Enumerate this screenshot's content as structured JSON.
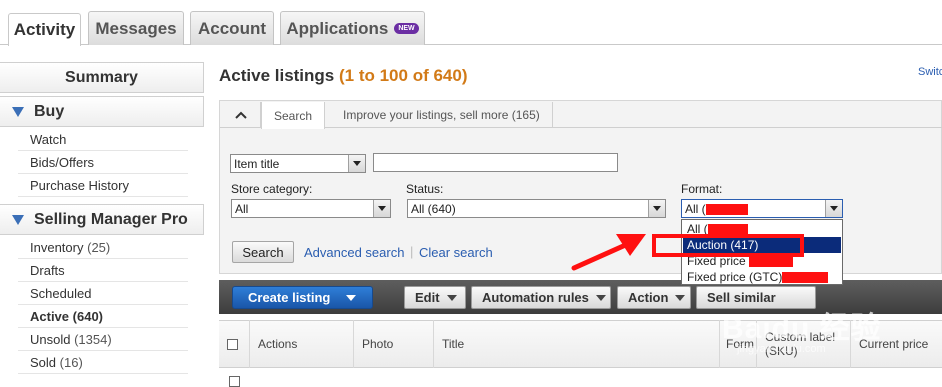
{
  "top_tabs": [
    {
      "label": "Activity",
      "active": true
    },
    {
      "label": "Messages"
    },
    {
      "label": "Account"
    },
    {
      "label": "Applications",
      "badge": "NEW"
    }
  ],
  "sidebar": {
    "summary": "Summary",
    "buy": {
      "title": "Buy",
      "items": [
        "Watch",
        "Bids/Offers",
        "Purchase History"
      ]
    },
    "smp": {
      "title": "Selling Manager Pro",
      "items": [
        {
          "label": "Inventory",
          "count": "(25)"
        },
        {
          "label": "Drafts",
          "count": ""
        },
        {
          "label": "Scheduled",
          "count": ""
        },
        {
          "label": "Active",
          "count": "(640)",
          "bold": true
        },
        {
          "label": "Unsold",
          "count": "(1354)"
        },
        {
          "label": "Sold",
          "count": "(16)"
        }
      ]
    }
  },
  "main": {
    "title_prefix": "Active listings",
    "title_range": "(1 to 100 of 640)",
    "switch_link": "Switc",
    "subtabs": {
      "search": "Search",
      "improve": "Improve your listings, sell more (165)"
    },
    "filters": {
      "keyword_type": "Item title",
      "keyword_value": "",
      "store_category_label": "Store category:",
      "store_category_value": "All",
      "status_label": "Status:",
      "status_value": "All (640)",
      "format_label": "Format:",
      "format_value": "All (",
      "format_options": [
        "All (",
        "Auction (417)",
        "Fixed price",
        "Fixed price (GTC)"
      ],
      "format_selected_index": 1
    },
    "search_button": "Search",
    "advanced_search": "Advanced search",
    "separator": "|",
    "clear_search": "Clear search",
    "toolbar": {
      "create_listing": "Create listing",
      "edit": "Edit",
      "automation_rules": "Automation rules",
      "action": "Action",
      "sell_similar": "Sell similar"
    },
    "table_headers": [
      "Actions",
      "Photo",
      "Title",
      "Form",
      "Custom label (SKU)",
      "Current price"
    ]
  },
  "watermark": {
    "brand": "Baidu 经验",
    "sub": "jingyan.baidu.com"
  },
  "colors": {
    "accent_blue": "#1a56a8",
    "range_orange": "#d27a17",
    "annotation_red": "#ff1010",
    "selected_option": "#0b2b7a"
  }
}
